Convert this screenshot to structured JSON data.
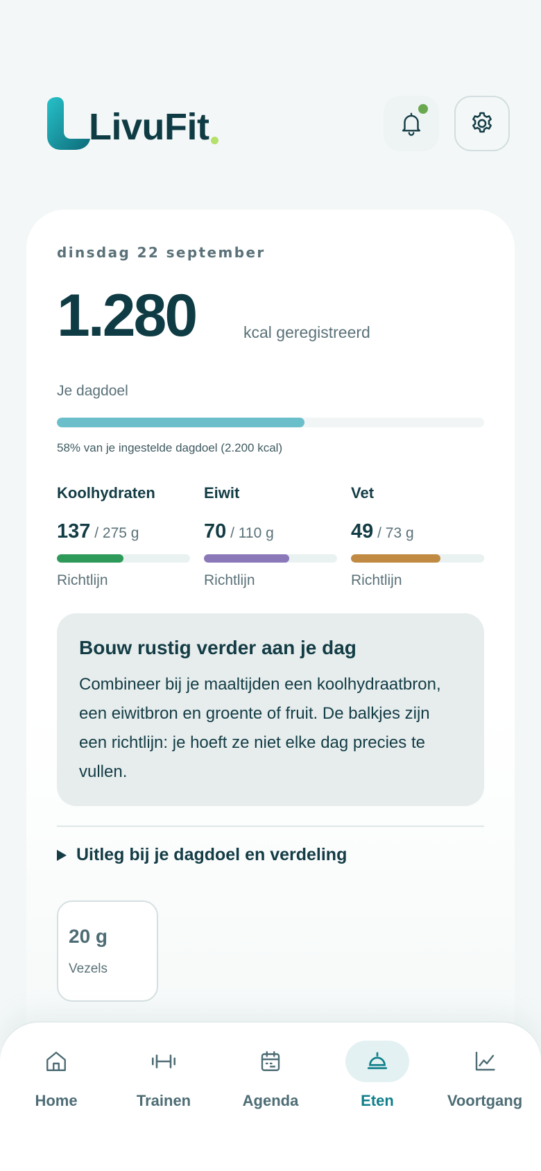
{
  "app": {
    "name": "LivuFit"
  },
  "header": {
    "notification_dot_color": "#6aa84f"
  },
  "summary": {
    "date": "dinsdag 22 september",
    "kcal": "1.280",
    "kcal_unit": "kcal geregistreerd",
    "goal_label": "Je dagdoel",
    "goal_fraction": 0.58,
    "goal_note": "58% van je ingestelde dagdoel (2.200 kcal)"
  },
  "macros": [
    {
      "name": "Koolhydraten",
      "current": "137",
      "goal": " / 275 g",
      "fraction": 0.5,
      "color": "#2e9a5a",
      "sub": "Richtlijn"
    },
    {
      "name": "Eiwit",
      "current": "70",
      "goal": " / 110 g",
      "fraction": 0.64,
      "color": "#8a78b8",
      "sub": "Richtlijn"
    },
    {
      "name": "Vet",
      "current": "49",
      "goal": " / 73 g",
      "fraction": 0.67,
      "color": "#c08a42",
      "sub": "Richtlijn"
    }
  ],
  "tip": {
    "title": "Bouw rustig verder aan je dag",
    "body": "Combineer bij je maaltijden een koolhydraatbron, een eiwitbron en groente of fruit. De balkjes zijn een richtlijn: je hoeft ze niet elke dag precies te vullen."
  },
  "expander": {
    "label": "Uitleg bij je dagdoel en verdeling"
  },
  "fiber": {
    "value": "20 g",
    "label": "Vezels"
  },
  "nav": {
    "items": [
      {
        "label": "Home",
        "icon": "home-icon"
      },
      {
        "label": "Trainen",
        "icon": "dumbbell-icon"
      },
      {
        "label": "Agenda",
        "icon": "calendar-icon"
      },
      {
        "label": "Eten",
        "icon": "cloche-icon",
        "active": true
      },
      {
        "label": "Voortgang",
        "icon": "chart-line-icon"
      }
    ]
  }
}
